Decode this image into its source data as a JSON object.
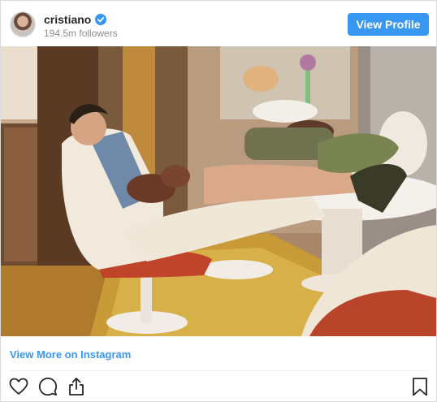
{
  "post": {
    "username": "cristiano",
    "followers": "194.5m followers",
    "view_profile_label": "View Profile",
    "view_more_label": "View More on Instagram"
  },
  "icons": {
    "verified": "verified-badge-icon",
    "like": "heart-icon",
    "comment": "comment-icon",
    "share": "share-icon",
    "save": "bookmark-icon"
  },
  "colors": {
    "accent": "#3897f0",
    "text": "#262626",
    "muted": "#8e8e8e"
  }
}
